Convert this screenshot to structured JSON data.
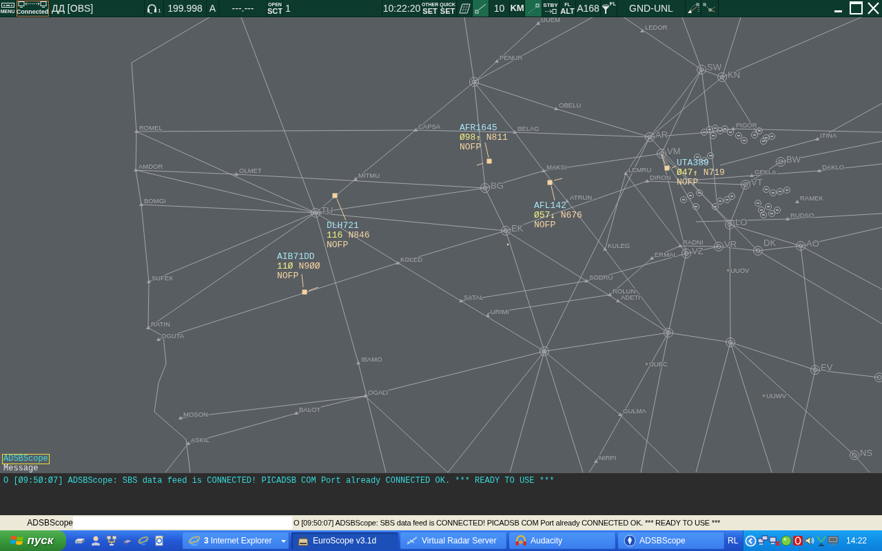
{
  "toolbar": {
    "cells": [
      {
        "kind": "menu",
        "label": "MENU"
      },
      {
        "kind": "connection",
        "label": "Connected"
      },
      {
        "kind": "callsign",
        "text": "ДД [OBS]"
      },
      {
        "kind": "headset",
        "subscript": "1"
      },
      {
        "kind": "frequency",
        "text": "199.998"
      },
      {
        "kind": "atis",
        "text": "A"
      },
      {
        "kind": "frequency",
        "text": "---.---"
      },
      {
        "kind": "sector_button",
        "top": "OPEN",
        "bottom": "SCT"
      },
      {
        "kind": "sector_count",
        "text": "1"
      },
      {
        "kind": "clock",
        "text": "10:22:20"
      },
      {
        "kind": "other_set_button",
        "top": "OTHER",
        "bottom": "SET"
      },
      {
        "kind": "quick_set_button",
        "top": "QUICK",
        "bottom": "SET"
      },
      {
        "kind": "map_tool",
        "on": false
      },
      {
        "kind": "line_tool",
        "on": true
      },
      {
        "kind": "range",
        "text": "10"
      },
      {
        "kind": "unit_button",
        "label": "KM"
      },
      {
        "kind": "dots_tool",
        "on": true
      },
      {
        "kind": "standby_button",
        "label": "STBY"
      },
      {
        "kind": "level_mode_button",
        "top": "FL",
        "bottom": "ALT"
      },
      {
        "kind": "altitude",
        "text": "A168"
      },
      {
        "kind": "filter_button",
        "label": "FL"
      },
      {
        "kind": "level_range",
        "text": "GND-UNL"
      },
      {
        "kind": "arc_tool",
        "on": false
      },
      {
        "kind": "path_tool",
        "on": false
      }
    ]
  },
  "map": {
    "waypoints": [
      "UUEM",
      "LEDOR",
      "PENUR",
      "OBELU",
      "ROMEL",
      "CAPSA",
      "BELAG",
      "PIGOR",
      "ITINA",
      "AMDOR",
      "OLMET",
      "MITMU",
      "MAKSI",
      "LEMRU",
      "DIRON",
      "DAKLO",
      "GEKLA",
      "BOMGI",
      "ATRUN",
      "RAMEK",
      "RUDSO",
      "RADNI",
      "KULEG",
      "ERMAL",
      "KOLED",
      "SODRU",
      "SUFEK",
      "ROLUN",
      "ADETI",
      "SATAL",
      "URIMI",
      "RATIN",
      "OGUTA",
      "IBAMO",
      "OGALI",
      "GULMA",
      "MOSON",
      "BALOT",
      "ASKIL",
      "NIRPI"
    ],
    "beacons": [
      "TU",
      "BG",
      "EK",
      "SW",
      "KN",
      "AR",
      "VM",
      "BW",
      "VT",
      "LO",
      "VZ",
      "VR",
      "DK",
      "AO",
      "EV",
      "NS"
    ],
    "airports": [
      "UUOV",
      "UUBC",
      "UUWV"
    ],
    "aircraft": [
      {
        "callsign": "AFR1645",
        "altitude": "Ø98",
        "trend": "↑",
        "speed": "N811",
        "status": "NOFP"
      },
      {
        "callsign": "UTA389",
        "altitude": "Ø47",
        "trend": "↑",
        "speed": "N719",
        "status": "NOFP"
      },
      {
        "callsign": "AFL142",
        "altitude": "Ø57",
        "trend": "↓",
        "speed": "N676",
        "status": "NOFP"
      },
      {
        "callsign": "DLH721",
        "altitude": "116",
        "speed": "N846",
        "status": "NOFP"
      },
      {
        "callsign": "AIB71DD",
        "altitude": "11Ø",
        "speed": "N9ØØ",
        "status": "NOFP"
      }
    ]
  },
  "chat": {
    "tabs": [
      {
        "label": "ADSBScope",
        "selected": true
      }
    ],
    "caption": "Message"
  },
  "log": [
    "O [Ø9:5Ø:Ø7] ADSBScope: SBS data feed is CONNECTED! PICADSB COM Port already CONNECTED OK. *** READY TO USE ***"
  ],
  "command_bar": {
    "label": "ADSBScope",
    "echo": "O [09:50:07] ADSBScope: SBS data feed is CONNECTED! PICADSB COM Port already CONNECTED OK. *** READY TO USE ***"
  },
  "taskbar": {
    "start_button": "пуск",
    "tasks": [
      {
        "count": "3",
        "label": "Internet Explorer",
        "grouped": true,
        "selected": false
      },
      {
        "label": "EuroScope v3.1d",
        "grouped": false,
        "selected": true
      },
      {
        "label": "Virtual Radar Server",
        "grouped": false,
        "selected": false
      },
      {
        "label": "Audacity",
        "grouped": false,
        "selected": false
      },
      {
        "label": "ADSBScope",
        "grouped": false,
        "selected": false
      }
    ],
    "tray": {
      "language": "RL",
      "clock": "14:22"
    }
  }
}
